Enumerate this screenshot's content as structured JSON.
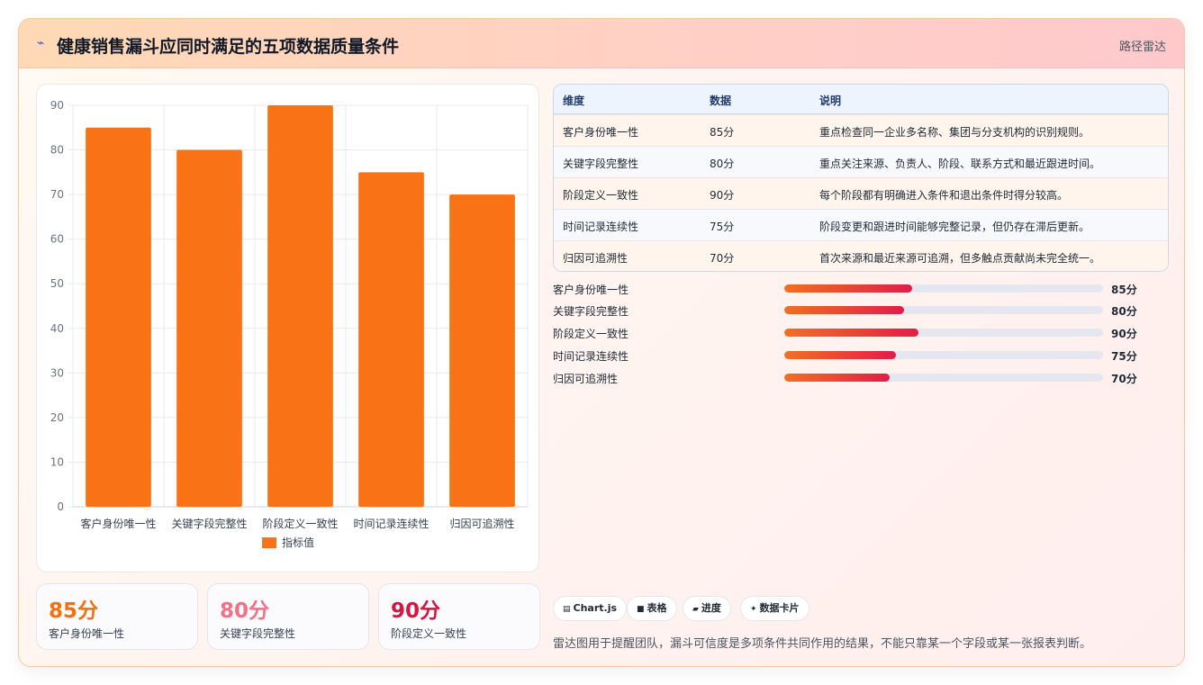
{
  "header": {
    "title": "健康销售漏斗应同时满足的五项数据质量条件",
    "tag": "路径雷达",
    "icon": "bolt-icon"
  },
  "chart_data": {
    "type": "bar",
    "categories": [
      "客户身份唯一性",
      "关键字段完整性",
      "阶段定义一致性",
      "时间记录连续性",
      "归因可追溯性"
    ],
    "series": [
      {
        "name": "指标值",
        "values": [
          85,
          80,
          90,
          75,
          70
        ],
        "color": "#f97316"
      }
    ],
    "y_ticks": [
      "0",
      "10",
      "20",
      "30",
      "40",
      "50",
      "60",
      "70",
      "80",
      "90"
    ],
    "ylim": [
      0,
      90
    ],
    "grid": true,
    "legend": "bottom"
  },
  "stats": [
    {
      "value": "85分",
      "label": "客户身份唯一性",
      "color": "#f4700e"
    },
    {
      "value": "80分",
      "label": "关键字段完整性",
      "color": "#f17187"
    },
    {
      "value": "90分",
      "label": "阶段定义一致性",
      "color": "#d6163f"
    }
  ],
  "table": {
    "headers": [
      "维度",
      "数据",
      "说明"
    ],
    "rows": [
      {
        "dim": "客户身份唯一性",
        "val": "85分",
        "desc": "重点检查同一企业多名称、集团与分支机构的识别规则。"
      },
      {
        "dim": "关键字段完整性",
        "val": "80分",
        "desc": "重点关注来源、负责人、阶段、联系方式和最近跟进时间。"
      },
      {
        "dim": "阶段定义一致性",
        "val": "90分",
        "desc": "每个阶段都有明确进入条件和退出条件时得分较高。"
      },
      {
        "dim": "时间记录连续性",
        "val": "75分",
        "desc": "阶段变更和跟进时间能够完整记录，但仍存在滞后更新。"
      },
      {
        "dim": "归因可追溯性",
        "val": "70分",
        "desc": "首次来源和最近来源可追溯，但多触点贡献尚未完全统一。"
      }
    ],
    "row_colors": [
      "#fff5ec",
      "#f8f9fc"
    ]
  },
  "progress": [
    {
      "label": "客户身份唯一性",
      "value_text": "85分",
      "fraction": 0.4
    },
    {
      "label": "关键字段完整性",
      "value_text": "80分",
      "fraction": 0.375
    },
    {
      "label": "阶段定义一致性",
      "value_text": "90分",
      "fraction": 0.42
    },
    {
      "label": "时间记录连续性",
      "value_text": "75分",
      "fraction": 0.35
    },
    {
      "label": "归因可追溯性",
      "value_text": "70分",
      "fraction": 0.33
    }
  ],
  "pills": [
    {
      "icon": "▤",
      "label": "Chart.js"
    },
    {
      "icon": "■",
      "label": "表格"
    },
    {
      "icon": "▰",
      "label": "进度"
    },
    {
      "icon": "✦",
      "label": "数据卡片"
    }
  ],
  "note": "雷达图用于提醒团队，漏斗可信度是多项条件共同作用的结果，不能只靠某一个字段或某一张报表判断。"
}
